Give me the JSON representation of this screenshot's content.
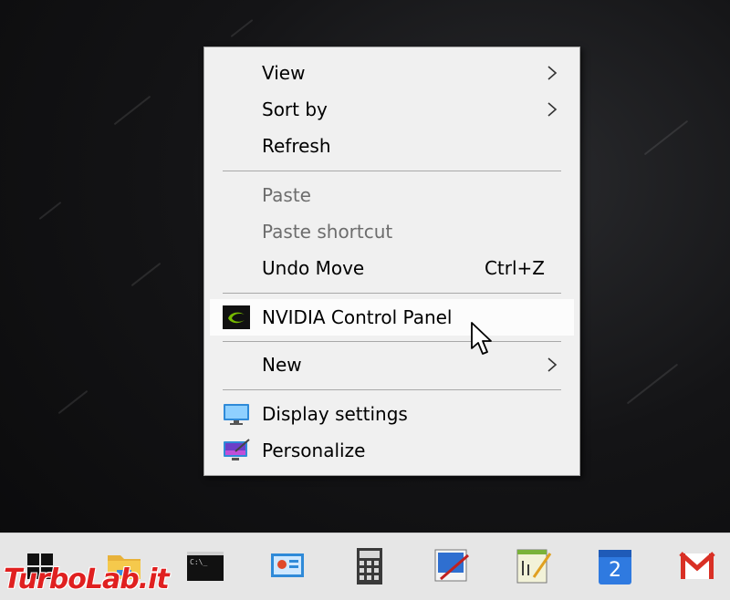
{
  "context_menu": {
    "items": [
      {
        "label": "View",
        "submenu": true
      },
      {
        "label": "Sort by",
        "submenu": true
      },
      {
        "label": "Refresh"
      },
      {
        "label": "Paste",
        "disabled": true
      },
      {
        "label": "Paste shortcut",
        "disabled": true
      },
      {
        "label": "Undo Move",
        "shortcut": "Ctrl+Z"
      },
      {
        "label": "NVIDIA Control Panel",
        "icon": "nvidia-icon",
        "highlighted": true
      },
      {
        "label": "New",
        "submenu": true
      },
      {
        "label": "Display settings",
        "icon": "display-settings-icon"
      },
      {
        "label": "Personalize",
        "icon": "personalize-icon"
      }
    ]
  },
  "taskbar": {
    "icons": [
      "windows-start-icon",
      "file-explorer-icon",
      "command-prompt-icon",
      "control-panel-icon",
      "calculator-icon",
      "paint-icon",
      "notepad-plus-icon",
      "calendar-icon",
      "gmail-icon"
    ],
    "calendar_day": "2"
  },
  "watermark": {
    "text": "TurboLab.it"
  },
  "colors": {
    "menu_bg": "#f0f0f0",
    "disabled_text": "#6d6d6d",
    "taskbar_bg": "#e6e6e6",
    "nvidia_green": "#76b900",
    "watermark_red": "#e02020"
  }
}
